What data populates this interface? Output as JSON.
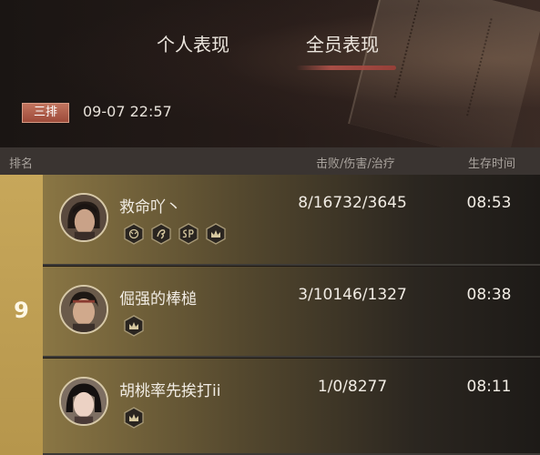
{
  "tabs": [
    {
      "label": "个人表现",
      "active": false
    },
    {
      "label": "全员表现",
      "active": true
    }
  ],
  "match": {
    "row_label": "三排",
    "timestamp": "09-07 22:57"
  },
  "header": {
    "rank": "排名",
    "stats": "击败/伤害/治疗",
    "survival": "生存时间"
  },
  "team": {
    "rank": "9",
    "players": [
      {
        "name": "救命吖丶",
        "stats": "8/16732/3645",
        "survival": "08:53",
        "badges": [
          "demon-mask-icon",
          "dragon-icon",
          "sp-icon",
          "crown-icon"
        ]
      },
      {
        "name": "倔强的棒槌",
        "stats": "3/10146/1327",
        "survival": "08:38",
        "badges": [
          "crown-icon"
        ]
      },
      {
        "name": "胡桃率先挨打ii",
        "stats": "1/0/8277",
        "survival": "08:11",
        "badges": [
          "crown-icon"
        ]
      }
    ]
  },
  "colors": {
    "rank_gold": "#c7a75a",
    "row_badge": "#b05c48",
    "accent_brush": "#b4524a"
  }
}
